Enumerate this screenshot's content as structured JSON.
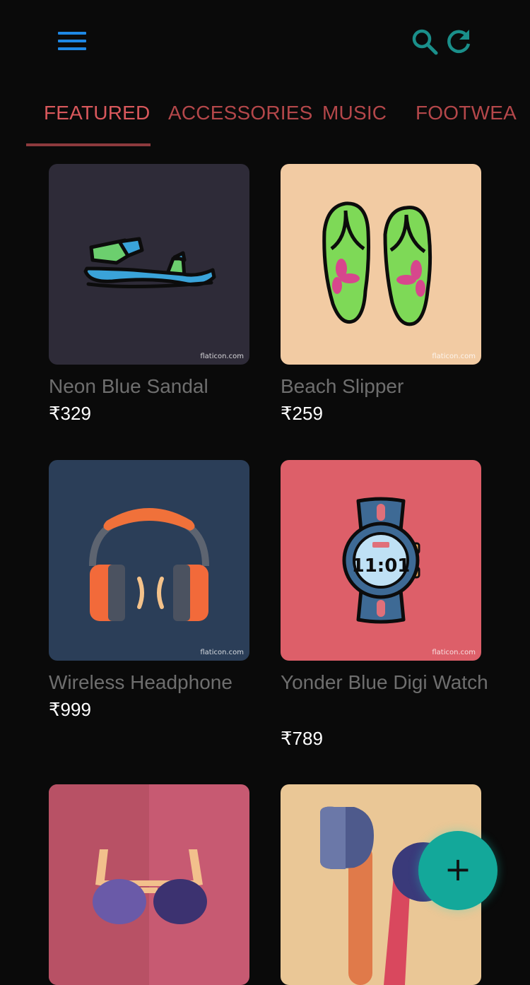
{
  "header": {
    "menu_icon": "hamburger-menu-icon",
    "search_icon": "search-icon",
    "refresh_icon": "refresh-icon",
    "accent_color": "#1a8f8a",
    "menu_color": "#1e88e5"
  },
  "tabs": [
    {
      "label": "FEATURED",
      "active": true
    },
    {
      "label": "ACCESSORIES",
      "active": false
    },
    {
      "label": "MUSIC",
      "active": false
    },
    {
      "label": "FOOTWEA",
      "active": false
    }
  ],
  "products": [
    {
      "name": "Neon Blue Sandal",
      "price": "₹329",
      "credit": "flaticon.com",
      "image_icon": "sandal-icon",
      "bg": "#2e2b38"
    },
    {
      "name": "Beach Slipper",
      "price": "₹259",
      "credit": "flaticon.com",
      "image_icon": "flip-flops-icon",
      "bg": "#f2cba3"
    },
    {
      "name": "Wireless Headphone",
      "price": "₹999",
      "credit": "flaticon.com",
      "image_icon": "headphones-icon",
      "bg": "#2b3e58"
    },
    {
      "name": "Yonder Blue Digi Watch",
      "price": "₹789",
      "credit": "flaticon.com",
      "image_icon": "smartwatch-icon",
      "bg": "#dd5f69",
      "watch_time": "11:01"
    },
    {
      "name": "",
      "price": "",
      "image_icon": "sunglasses-icon",
      "bg": "#c75a72"
    },
    {
      "name": "",
      "price": "",
      "image_icon": "earbuds-icon",
      "bg": "#eac796"
    }
  ],
  "fab": {
    "label": "+",
    "icon": "add-icon",
    "color": "#13a89a"
  }
}
